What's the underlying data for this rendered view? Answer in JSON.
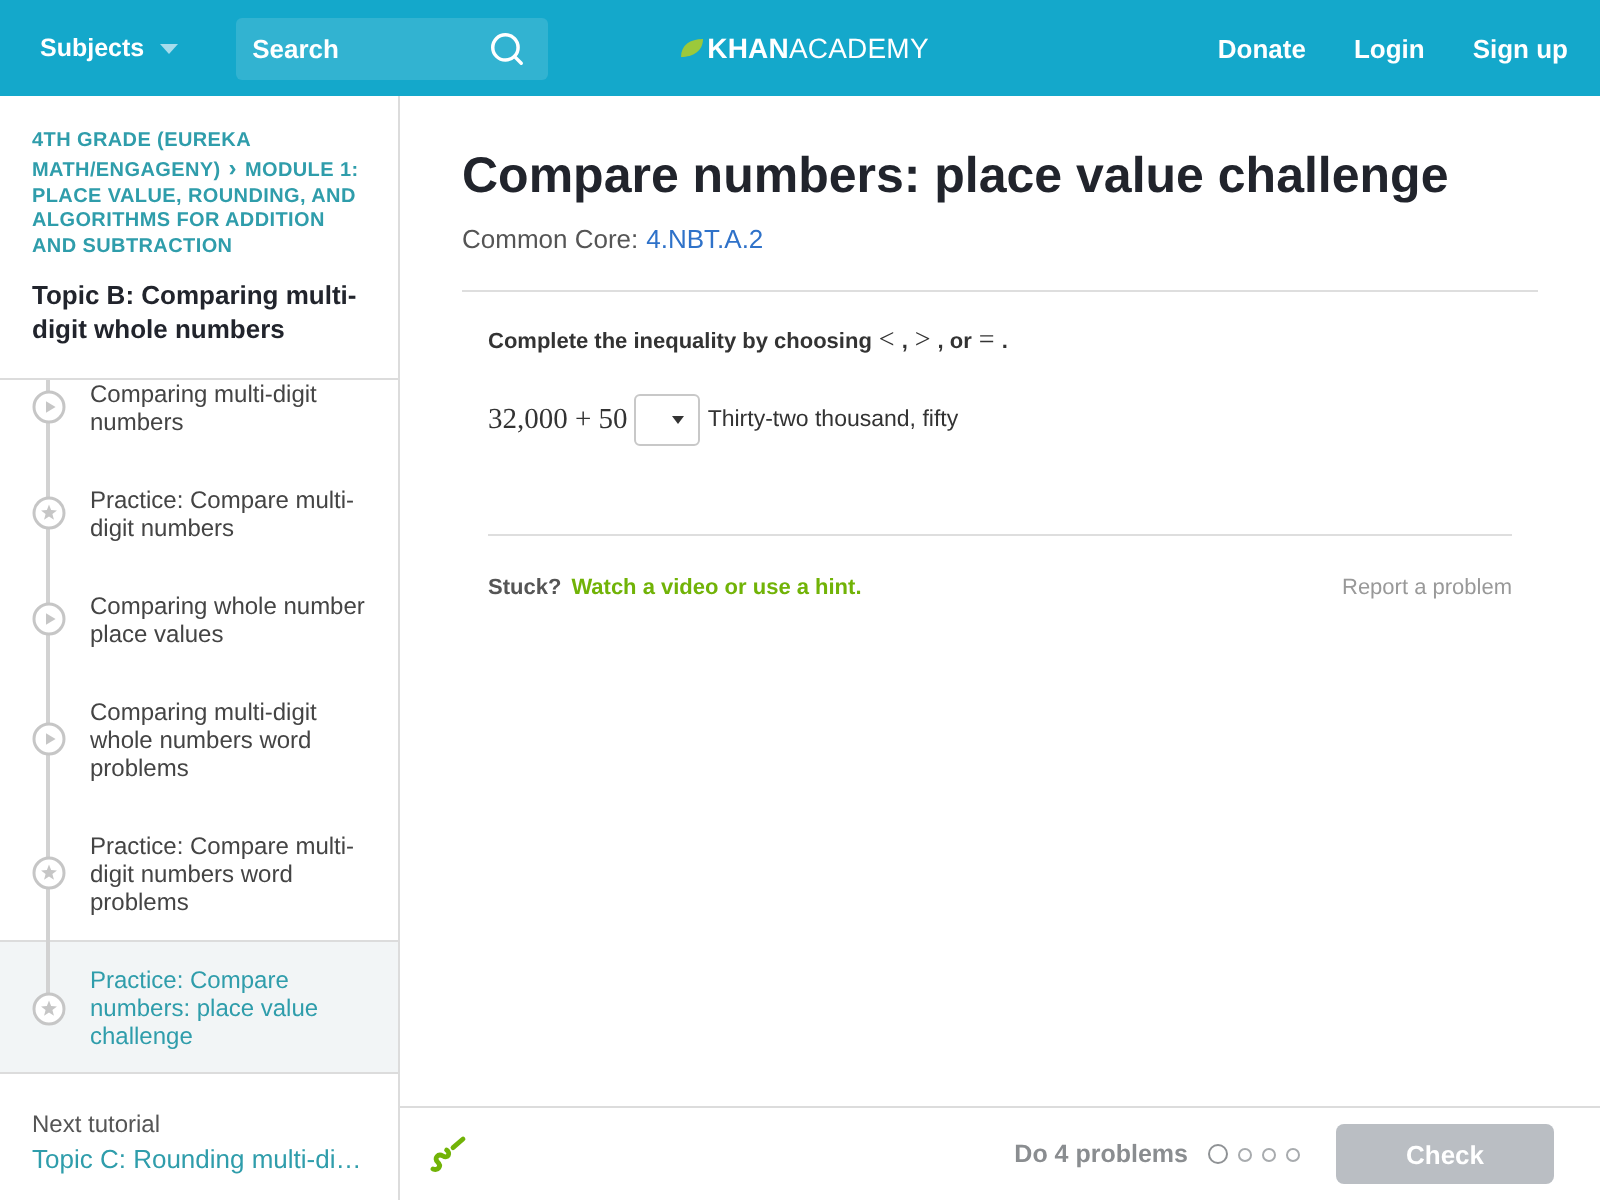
{
  "header": {
    "subjects_menu": "Subjects",
    "search": {
      "placeholder": "Search"
    },
    "logo": "**KHAN**ACADEMY",
    "nav_links": [
      "Donate",
      "Login",
      "Sign up"
    ]
  },
  "sidebar": {
    "breadcrumb": [
      "4TH GRADE (EUREKA MATH/ENGAGENY)",
      "MODULE 1: PLACE VALUE, ROUNDING, AND ALGORITHMS FOR ADDITION AND SUBTRACTION"
    ],
    "breadcrumb_separator": "›",
    "topic_title": "Topic B: Comparing multi-digit whole numbers",
    "items": [
      {
        "kind": "video",
        "label": "Comparing multi-digit numbers",
        "selected": false
      },
      {
        "kind": "practice",
        "label": "Practice: Compare multi-digit numbers",
        "selected": false
      },
      {
        "kind": "video",
        "label": "Comparing whole number place values",
        "selected": false
      },
      {
        "kind": "video",
        "label": "Comparing multi-digit whole numbers word problems",
        "selected": false
      },
      {
        "kind": "practice",
        "label": "Practice: Compare multi-digit numbers word problems",
        "selected": false
      },
      {
        "kind": "practice",
        "label": "Practice: Compare numbers: place value challenge",
        "selected": true
      }
    ],
    "next_tutorial": {
      "caption": "Next tutorial",
      "title": "Topic C: Rounding multi-di…"
    }
  },
  "exercise": {
    "title": "Compare numbers: place value challenge",
    "standard": {
      "label": "Common Core:",
      "code": "4.NBT.A.2"
    },
    "question": {
      "prompt": "**Complete the inequality by choosing** < **,** > **, or** = **.**",
      "left_side": "32,000 + 50",
      "right_side": "Thirty-two thousand, fifty"
    },
    "help": {
      "label": "Stuck?",
      "link": "Watch a video or use a hint.",
      "report": "Report a problem"
    }
  },
  "footer": {
    "goal": "Do 4 problems",
    "problems": [
      {
        "current": true
      },
      {
        "current": false
      },
      {
        "current": false
      },
      {
        "current": false
      }
    ],
    "check_button": {
      "label": "Check",
      "disabled": true
    }
  }
}
